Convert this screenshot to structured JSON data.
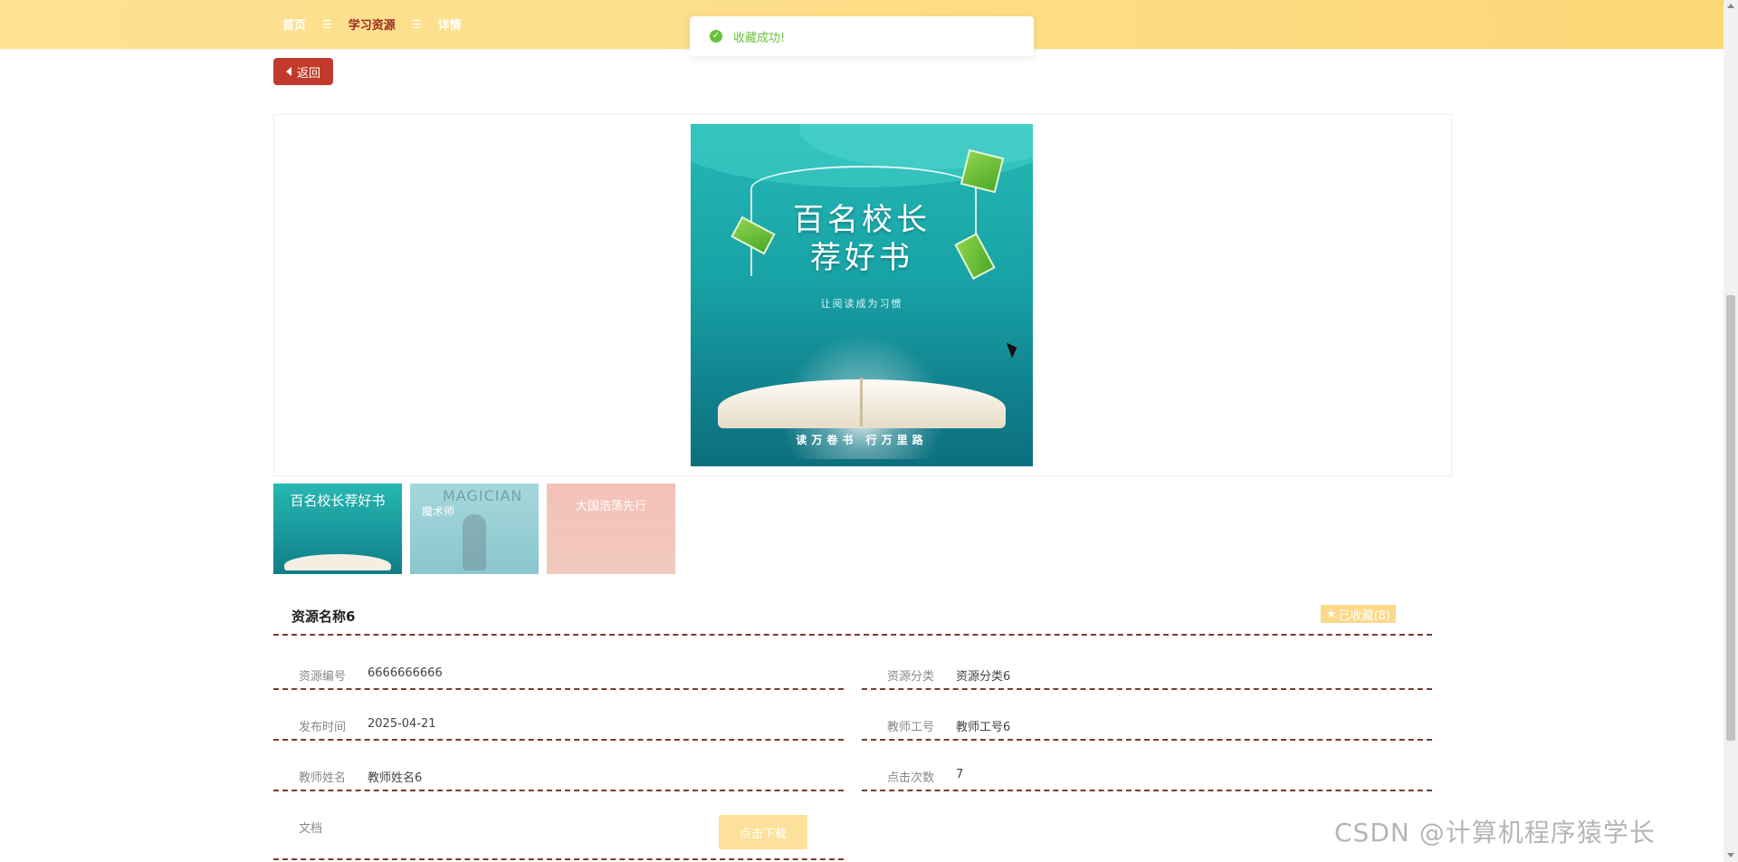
{
  "breadcrumb": {
    "items": [
      "首页",
      "学习资源",
      "详情"
    ],
    "separator": "☰"
  },
  "toast": {
    "message": "收藏成功!",
    "icon": "check-circle-icon",
    "color": "#67c23a"
  },
  "back_button": {
    "label": "返回",
    "icon": "caret-left-icon"
  },
  "cover": {
    "title_line1": "百名校长",
    "title_line2": "荐好书",
    "subtitle": "让阅读成为习惯",
    "footer": "读万卷书 行万里路"
  },
  "thumbnails": [
    {
      "title": "百名校长荐好书"
    },
    {
      "title": "魔术师",
      "overlay": "MAGICIAN"
    },
    {
      "title": "大国浩荡先行"
    }
  ],
  "detail": {
    "title": "资源名称6",
    "favorite": {
      "label": "已收藏(8)",
      "icon": "star-icon"
    },
    "fields": [
      {
        "label": "资源编号",
        "value": "6666666666"
      },
      {
        "label": "资源分类",
        "value": "资源分类6"
      },
      {
        "label": "发布时间",
        "value": "2025-04-21"
      },
      {
        "label": "教师工号",
        "value": "教师工号6"
      },
      {
        "label": "教师姓名",
        "value": "教师姓名6"
      },
      {
        "label": "点击次数",
        "value": "7"
      },
      {
        "label": "文档",
        "value": ""
      }
    ],
    "download_label": "点击下载"
  },
  "watermark": "CSDN @计算机程序猿学长",
  "colors": {
    "topbar": "#fddc84",
    "back_button": "#c23a2b",
    "accent": "#fcd88a",
    "divider": "#7a3b34"
  }
}
